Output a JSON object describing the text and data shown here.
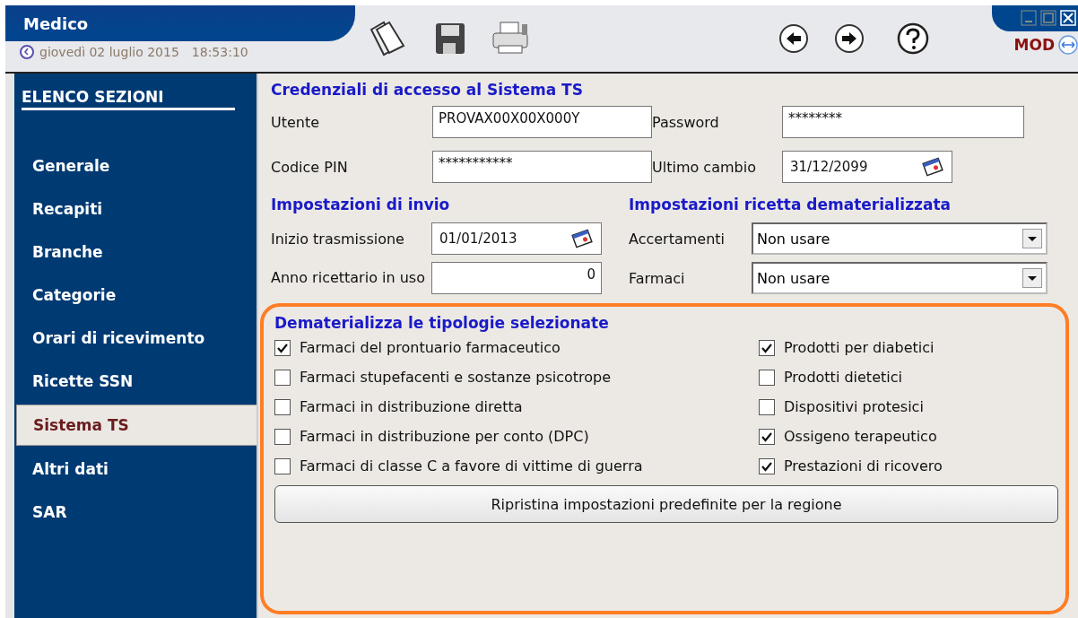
{
  "window": {
    "title": "Medico",
    "date": "giovedì 02 luglio 2015",
    "time": "18:53:10",
    "mode": "MOD"
  },
  "sidebar": {
    "heading": "ELENCO SEZIONI",
    "items": [
      {
        "label": "Generale",
        "selected": false
      },
      {
        "label": "Recapiti",
        "selected": false
      },
      {
        "label": "Branche",
        "selected": false
      },
      {
        "label": "Categorie",
        "selected": false
      },
      {
        "label": "Orari di ricevimento",
        "selected": false
      },
      {
        "label": "Ricette SSN",
        "selected": false
      },
      {
        "label": "Sistema TS",
        "selected": true
      },
      {
        "label": "Altri dati",
        "selected": false
      },
      {
        "label": "SAR",
        "selected": false
      }
    ]
  },
  "credentials": {
    "title": "Credenziali di accesso al Sistema TS",
    "user": {
      "label": "Utente",
      "value": "PROVAX00X00X000Y"
    },
    "password": {
      "label": "Password",
      "value": "********"
    },
    "pin": {
      "label": "Codice PIN",
      "value": "***********"
    },
    "last_change": {
      "label": "Ultimo cambio",
      "value": "31/12/2099"
    }
  },
  "send": {
    "title": "Impostazioni di invio",
    "start": {
      "label": "Inizio trasmissione",
      "value": "01/01/2013"
    },
    "year": {
      "label": "Anno ricettario in uso",
      "value": "0"
    }
  },
  "prescription": {
    "title": "Impostazioni ricetta dematerializzata",
    "exams": {
      "label": "Accertamenti",
      "value": "Non usare"
    },
    "drugs": {
      "label": "Farmaci",
      "value": "Non usare"
    }
  },
  "types": {
    "title": "Dematerializza le tipologie selezionate",
    "left": [
      {
        "label": "Farmaci del prontuario farmaceutico",
        "checked": true
      },
      {
        "label": "Farmaci stupefacenti e sostanze psicotrope",
        "checked": false
      },
      {
        "label": "Farmaci in distribuzione diretta",
        "checked": false
      },
      {
        "label": "Farmaci in distribuzione per conto (DPC)",
        "checked": false
      },
      {
        "label": "Farmaci di classe C a favore di vittime di guerra",
        "checked": false
      }
    ],
    "right": [
      {
        "label": "Prodotti per diabetici",
        "checked": true
      },
      {
        "label": "Prodotti dietetici",
        "checked": false
      },
      {
        "label": "Dispositivi protesici",
        "checked": false
      },
      {
        "label": "Ossigeno terapeutico",
        "checked": true
      },
      {
        "label": "Prestazioni di ricovero",
        "checked": true
      }
    ],
    "reset_button": "Ripristina impostazioni predefinite per la regione"
  }
}
